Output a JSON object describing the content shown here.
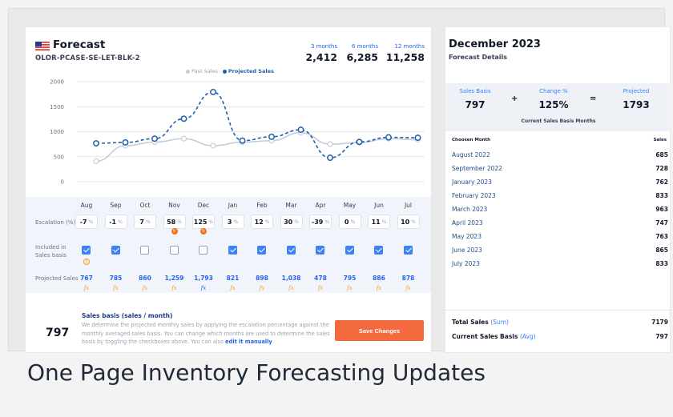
{
  "header": {
    "title": "Forecast",
    "sku": "OLOR-PCASE-SE-LET-BLK-2",
    "periods": [
      {
        "label": "3 months",
        "value": "2,412"
      },
      {
        "label": "6 months",
        "value": "6,285"
      },
      {
        "label": "12 months",
        "value": "11,258"
      }
    ]
  },
  "legend": {
    "past": "Past Sales",
    "projected": "Projected Sales"
  },
  "colors": {
    "accent": "#2563eb",
    "projected_line": "#1e60a8",
    "past_line": "#c5cdd8",
    "save_button": "#f26a3d",
    "warning": "#f97316"
  },
  "chart_data": {
    "type": "line",
    "categories": [
      "Aug",
      "Sep",
      "Oct",
      "Nov",
      "Dec",
      "Jan",
      "Feb",
      "Mar",
      "Apr",
      "May",
      "Jun",
      "Jul"
    ],
    "series": [
      {
        "name": "Past Sales",
        "values": [
          410,
          720,
          790,
          860,
          720,
          790,
          820,
          980,
          750,
          780,
          860,
          840
        ]
      },
      {
        "name": "Projected Sales",
        "values": [
          767,
          785,
          860,
          1259,
          1793,
          821,
          898,
          1038,
          478,
          795,
          886,
          878
        ]
      }
    ],
    "ylim": [
      0,
      2000
    ],
    "yticks": [
      "0",
      "500",
      "1000",
      "1500",
      "2000"
    ],
    "grid": true,
    "legend_position": "top"
  },
  "table": {
    "row_labels": {
      "escalation": "Escalation (%)",
      "included": "Included in Sales basis",
      "projected": "Projected Sales"
    },
    "pct_sign": "%",
    "fx": "fx",
    "months": [
      {
        "m": "Aug",
        "esc": "-7",
        "inc": true,
        "proj": "767",
        "warn": false,
        "info": true,
        "fx_blue": false
      },
      {
        "m": "Sep",
        "esc": "-1",
        "inc": true,
        "proj": "785",
        "warn": false,
        "info": false,
        "fx_blue": false
      },
      {
        "m": "Oct",
        "esc": "7",
        "inc": false,
        "proj": "860",
        "warn": false,
        "info": false,
        "fx_blue": false
      },
      {
        "m": "Nov",
        "esc": "58",
        "inc": false,
        "proj": "1,259",
        "warn": true,
        "info": false,
        "fx_blue": false
      },
      {
        "m": "Dec",
        "esc": "125",
        "inc": false,
        "proj": "1,793",
        "warn": true,
        "info": false,
        "fx_blue": true
      },
      {
        "m": "Jan",
        "esc": "3",
        "inc": true,
        "proj": "821",
        "warn": false,
        "info": false,
        "fx_blue": false
      },
      {
        "m": "Feb",
        "esc": "12",
        "inc": true,
        "proj": "898",
        "warn": false,
        "info": false,
        "fx_blue": false
      },
      {
        "m": "Mar",
        "esc": "30",
        "inc": true,
        "proj": "1,038",
        "warn": false,
        "info": false,
        "fx_blue": false
      },
      {
        "m": "Apr",
        "esc": "-39",
        "inc": true,
        "proj": "478",
        "warn": false,
        "info": false,
        "fx_blue": false
      },
      {
        "m": "May",
        "esc": "0",
        "inc": true,
        "proj": "795",
        "warn": false,
        "info": false,
        "fx_blue": false
      },
      {
        "m": "Jun",
        "esc": "11",
        "inc": true,
        "proj": "886",
        "warn": false,
        "info": false,
        "fx_blue": false
      },
      {
        "m": "Jul",
        "esc": "10",
        "inc": true,
        "proj": "878",
        "warn": false,
        "info": false,
        "fx_blue": false
      }
    ]
  },
  "sales_basis": {
    "value": "797",
    "title": "Sales basis (sales / month)",
    "description": "We determine the projected monthly sales by applying the escalation percentage against the monthly averaged sales basis. You can change which months are used to determine the sales basis by toggling the checkboxes above. You can also",
    "link": "edit it manually",
    "save_label": "Save Changes"
  },
  "right": {
    "title": "December 2023",
    "subtitle": "Forecast Details",
    "calc": {
      "basis_label": "Sales Basis",
      "basis_value": "797",
      "plus": "+",
      "change_label": "Change %",
      "change_value": "125%",
      "equals": "=",
      "projected_label": "Projected",
      "projected_value": "1793"
    },
    "current_basis_months": "Current Sales Basis Months",
    "col_month": "Choosen Month",
    "col_sales": "Sales",
    "rows": [
      {
        "month": "August 2022",
        "sales": "685"
      },
      {
        "month": "September 2022",
        "sales": "728"
      },
      {
        "month": "January 2023",
        "sales": "762"
      },
      {
        "month": "February 2023",
        "sales": "833"
      },
      {
        "month": "March 2023",
        "sales": "963"
      },
      {
        "month": "April 2023",
        "sales": "747"
      },
      {
        "month": "May 2023",
        "sales": "763"
      },
      {
        "month": "June 2023",
        "sales": "865"
      },
      {
        "month": "July 2023",
        "sales": "833"
      }
    ],
    "total_label": "Total Sales",
    "total_hint": "(Sum)",
    "total_value": "7179",
    "current_label": "Current Sales Basis",
    "current_hint": "(Avg)",
    "current_value": "797"
  },
  "caption": "One Page Inventory Forecasting Updates"
}
